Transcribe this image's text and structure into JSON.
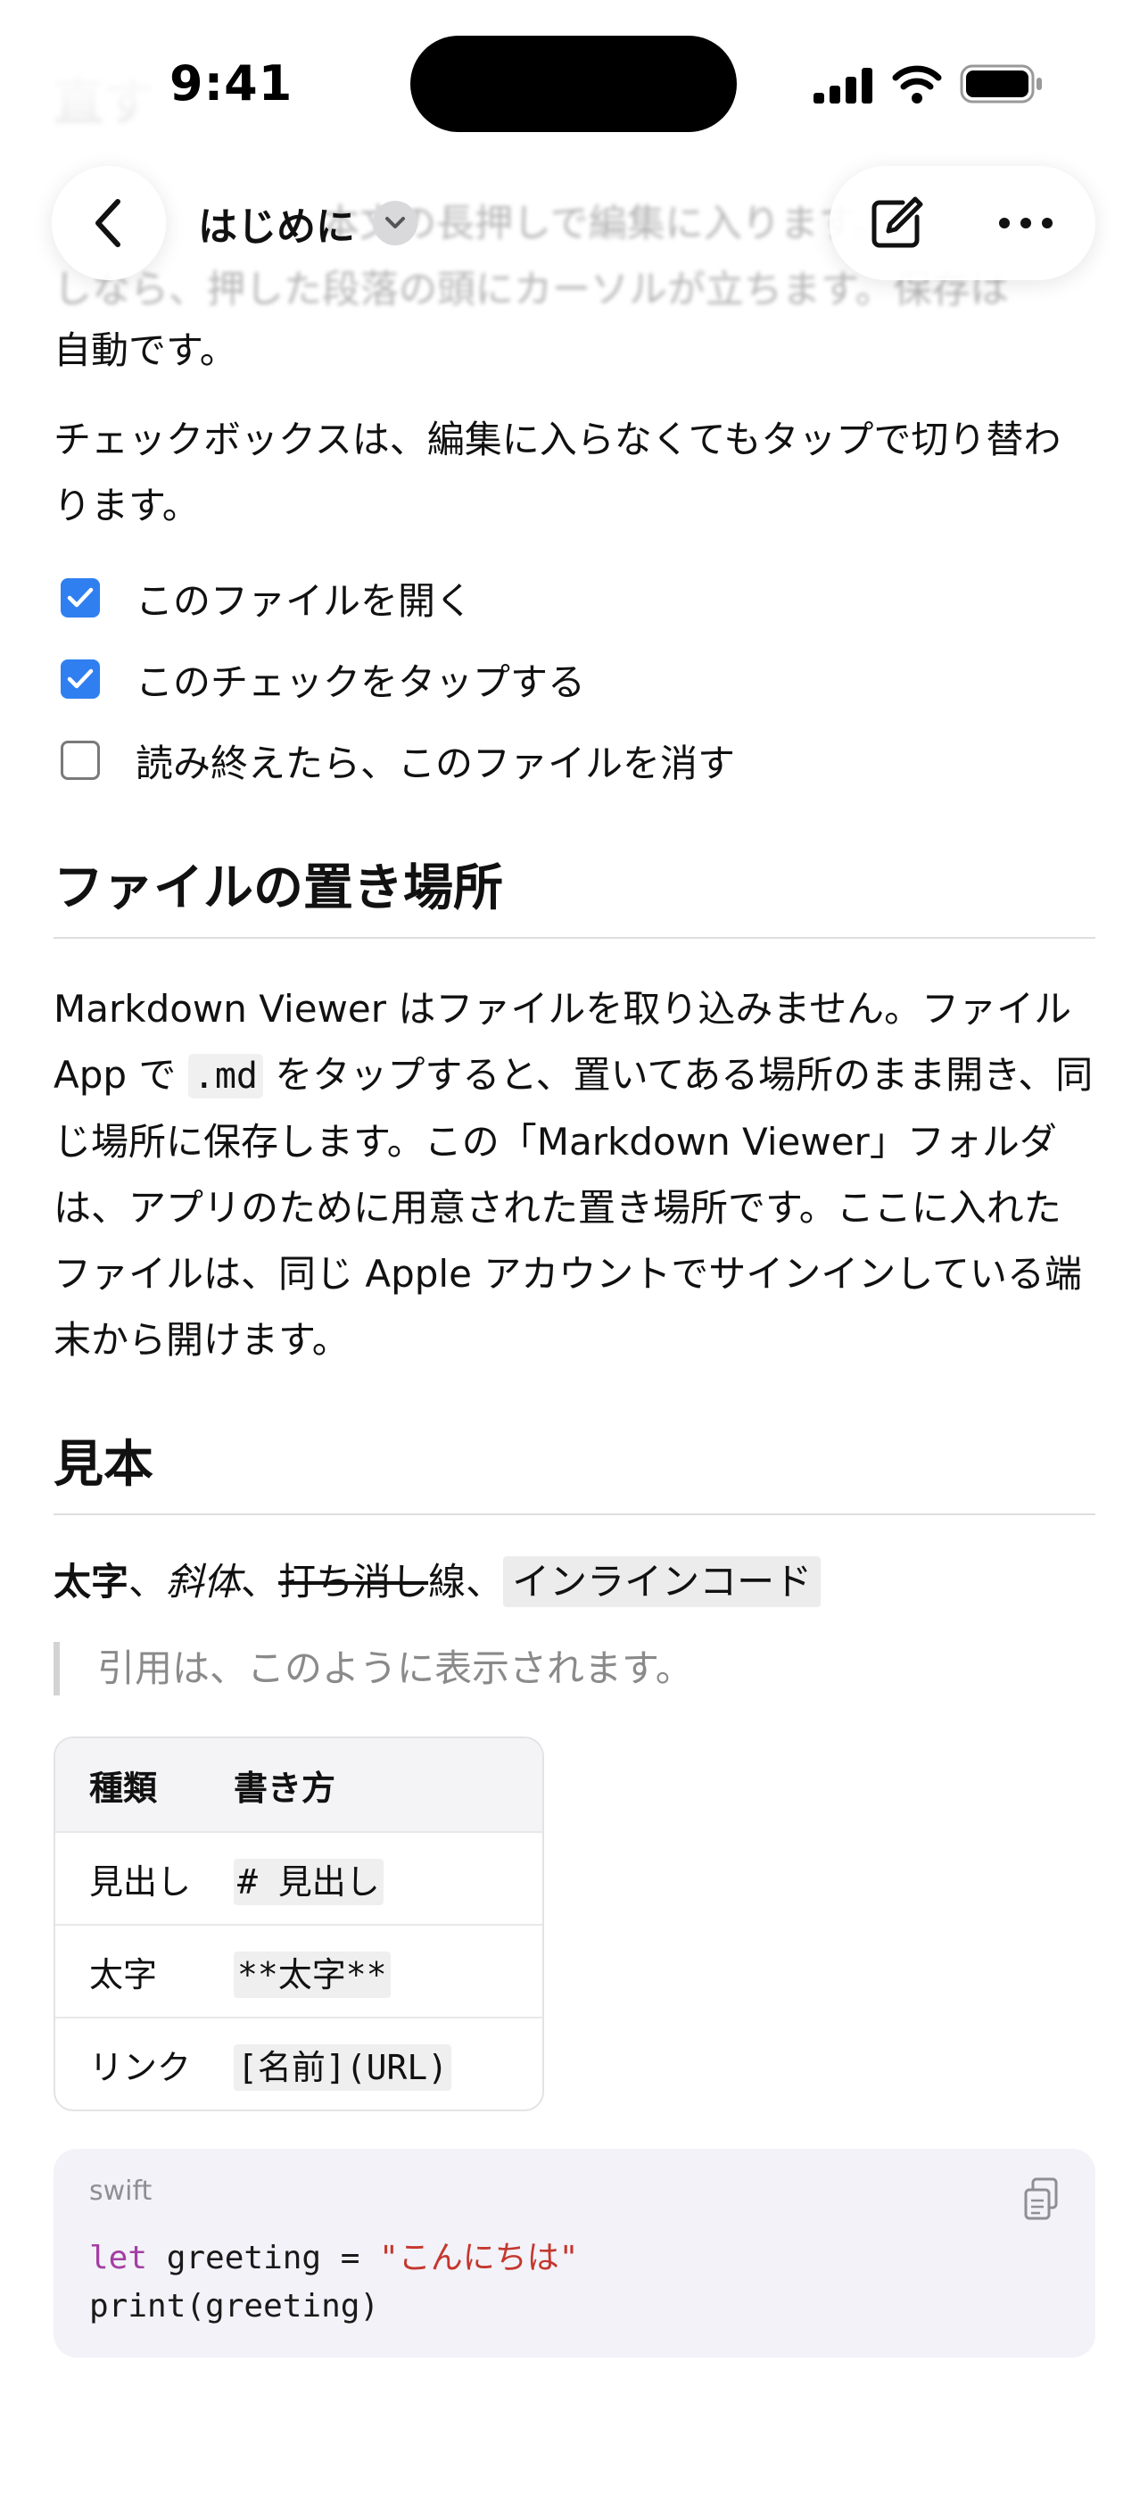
{
  "status_bar": {
    "time": "9:41"
  },
  "nav": {
    "title": "はじめに",
    "back_icon": "chevron-left-icon",
    "title_menu_icon": "chevron-down-icon",
    "edit_icon": "compose-icon",
    "more_icon": "ellipsis-icon"
  },
  "doc": {
    "faded_heading": "直す",
    "faded_line_1": "本文の長押しで編集に入ります。",
    "faded_line_2": "しなら、押した段落の頭にカーソルが立ちます。保存は",
    "autosave_tail": "自動です。",
    "checkbox_paragraph": "チェックボックスは、編集に入らなくてもタップで切り替わります。",
    "checklist": [
      {
        "label": "このファイルを開く",
        "checked": true
      },
      {
        "label": "このチェックをタップする",
        "checked": true
      },
      {
        "label": "読み終えたら、このファイルを消す",
        "checked": false
      }
    ],
    "heading_location": "ファイルの置き場所",
    "location_paragraph": {
      "part1": "Markdown Viewer はファイルを取り込みません。ファイル App で ",
      "code": ".md",
      "part2": " をタップすると、置いてある場所のまま開き、同じ場所に保存します。この「Markdown Viewer」フォルダは、アプリのために用意された置き場所です。ここに入れたファイルは、同じ Apple アカウントでサインインしている端末から開けます。"
    },
    "heading_sample": "見本",
    "sample": {
      "bold": "太字",
      "sep1": "、",
      "italic": "斜体",
      "sep2": "、",
      "strike": "打ち消し",
      "plain": "線",
      "sep3": "、",
      "code": "インラインコード"
    },
    "blockquote": "引用は、このように表示されます。",
    "table": {
      "headers": [
        "種類",
        "書き方"
      ],
      "rows": [
        [
          "見出し",
          "# 見出し"
        ],
        [
          "太字",
          "**太字**"
        ],
        [
          "リンク",
          "[名前](URL)"
        ]
      ]
    },
    "code_block": {
      "language": "swift",
      "copy_icon": "copy-icon",
      "line1_keyword": "let",
      "line1_rest": " greeting = ",
      "line1_string": "\"こんにちは\"",
      "line2": "print(greeting)"
    }
  },
  "colors": {
    "accent": "#2f7ff0",
    "keyword": "#a33fa3",
    "string": "#c4372d"
  }
}
